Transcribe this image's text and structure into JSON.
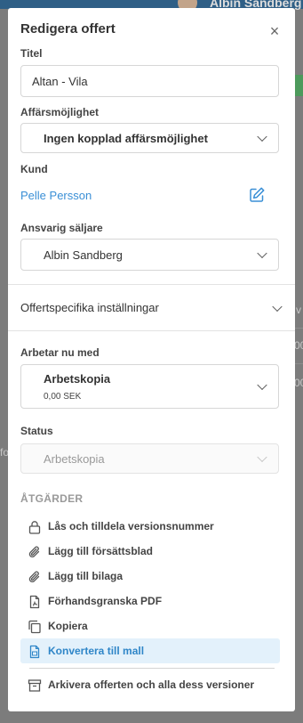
{
  "background": {
    "user_name": "Albin Sandberg",
    "fragments": [
      "v",
      "00",
      "00",
      "fo"
    ]
  },
  "modal": {
    "title": "Redigera offert",
    "close_symbol": "×",
    "title_field": {
      "label": "Titel",
      "value": "Altan - Vila"
    },
    "opportunity": {
      "label": "Affärsmöjlighet",
      "value": "Ingen kopplad affärsmöjlighet"
    },
    "customer": {
      "label": "Kund",
      "name": "Pelle Persson",
      "edit_icon": "pencil-square-icon"
    },
    "seller": {
      "label": "Ansvarig säljare",
      "value": "Albin Sandberg"
    },
    "settings_section": {
      "label": "Offertspecifika inställningar"
    },
    "working_on": {
      "label": "Arbetar nu med",
      "name": "Arbetskopia",
      "amount": "0,00 SEK"
    },
    "status": {
      "label": "Status",
      "value": "Arbetskopia"
    },
    "actions_header": "ÅTGÄRDER",
    "actions": [
      {
        "label": "Lås och tilldela versionsnummer",
        "icon": "lock-icon"
      },
      {
        "label": "Lägg till försättsblad",
        "icon": "paperclip-icon"
      },
      {
        "label": "Lägg till bilaga",
        "icon": "paperclip-icon"
      },
      {
        "label": "Förhandsgranska PDF",
        "icon": "pdf-file-icon"
      },
      {
        "label": "Kopiera",
        "icon": "copy-icon"
      },
      {
        "label": "Konvertera till mall",
        "icon": "template-file-icon",
        "active": true
      },
      {
        "label": "Arkivera offerten och alla dess versioner",
        "icon": "archive-icon"
      }
    ]
  },
  "colors": {
    "link": "#3a8fd6",
    "active_bg": "#e3f1fb",
    "overlay": "#7c7c7c"
  }
}
